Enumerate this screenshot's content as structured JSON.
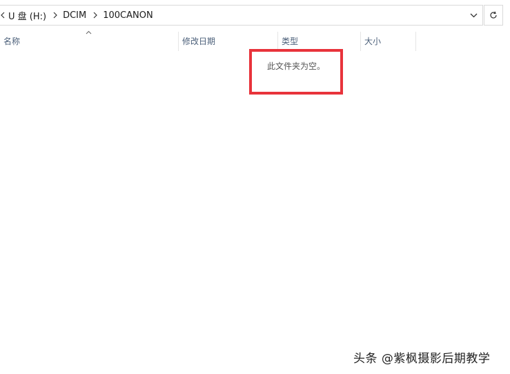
{
  "address_bar": {
    "breadcrumbs": [
      "U 盘 (H:)",
      "DCIM",
      "100CANON"
    ],
    "dropdown_icon": "chevron-down-icon",
    "refresh_icon": "refresh-icon"
  },
  "columns": {
    "name": "名称",
    "modified": "修改日期",
    "type": "类型",
    "size": "大小",
    "sort_indicator": "sort-ascending-icon"
  },
  "content": {
    "empty_message": "此文件夹为空。"
  },
  "annotation": {
    "highlight_color": "#e8333b"
  },
  "watermark": {
    "text": "头条 @紫枫摄影后期教学"
  }
}
